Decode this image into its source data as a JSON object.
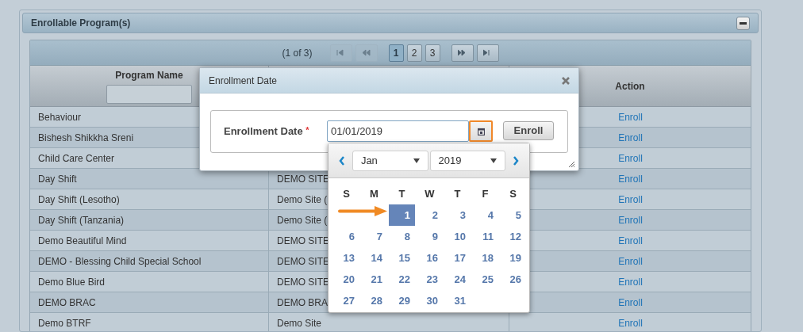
{
  "panel": {
    "title": "Enrollable Program(s)",
    "collapsed": false
  },
  "paginator": {
    "summary": "(1 of 3)",
    "nav": [
      {
        "kind": "first",
        "disabled": true
      },
      {
        "kind": "prev",
        "disabled": true
      },
      {
        "kind": "next",
        "disabled": false
      },
      {
        "kind": "last",
        "disabled": false
      }
    ],
    "pages": [
      {
        "label": "1",
        "selected": true
      },
      {
        "label": "2",
        "selected": false
      },
      {
        "label": "3",
        "selected": false
      }
    ]
  },
  "table": {
    "columns": [
      {
        "label": "Program Name",
        "filter": true
      },
      {
        "label": "Action",
        "filter": false
      }
    ],
    "rows": [
      {
        "name": "Behaviour",
        "action": "Enroll"
      },
      {
        "name": "Bishesh Shikkha Sreni",
        "action": "Enroll"
      },
      {
        "name": "Child Care Center",
        "action": "Enroll"
      },
      {
        "name": "Day Shift",
        "column_2": "DEMO SITE",
        "action": "Enroll"
      },
      {
        "name": "Day Shift (Lesotho)",
        "column_2": "Demo Site (",
        "action": "Enroll"
      },
      {
        "name": "Day Shift (Tanzania)",
        "column_2": "Demo Site (",
        "action": "Enroll"
      },
      {
        "name": "Demo Beautiful Mind",
        "column_2": "DEMO SITE",
        "action": "Enroll"
      },
      {
        "name": "DEMO - Blessing Child Special School",
        "column_2": "DEMO SITE",
        "action": "Enroll"
      },
      {
        "name": "Demo Blue Bird",
        "column_2": "DEMO SITE",
        "action": "Enroll"
      },
      {
        "name": "DEMO BRAC",
        "column_2": "DEMO BRA",
        "action": "Enroll"
      },
      {
        "name": "Demo BTRF",
        "column_2": "Demo Site",
        "action": "Enroll"
      }
    ]
  },
  "dialog": {
    "title": "Enrollment Date",
    "field_label": "Enrollment Date",
    "required_mark": "*",
    "value": "01/01/2019",
    "calendar_button_focused": true,
    "button": "Enroll"
  },
  "datepicker": {
    "month": "Jan",
    "year": "2019",
    "weekdays": [
      "S",
      "M",
      "T",
      "W",
      "T",
      "F",
      "S"
    ],
    "weeks": [
      [
        {
          "label": "1",
          "selected": true
        },
        {
          "label": "2",
          "selected": false
        },
        {
          "label": "3",
          "selected": false
        },
        {
          "label": "4",
          "selected": false
        },
        {
          "label": "5",
          "selected": false
        }
      ],
      [
        {
          "label": "6",
          "selected": false
        },
        {
          "label": "7",
          "selected": false
        },
        {
          "label": "8",
          "selected": false
        },
        {
          "label": "9",
          "selected": false
        },
        {
          "label": "10",
          "selected": false
        },
        {
          "label": "11",
          "selected": false
        },
        {
          "label": "12",
          "selected": false
        }
      ],
      [
        {
          "label": "13",
          "selected": false
        },
        {
          "label": "14",
          "selected": false
        },
        {
          "label": "15",
          "selected": false
        },
        {
          "label": "16",
          "selected": false
        },
        {
          "label": "17",
          "selected": false
        },
        {
          "label": "18",
          "selected": false
        },
        {
          "label": "19",
          "selected": false
        }
      ],
      [
        {
          "label": "20",
          "selected": false
        },
        {
          "label": "21",
          "selected": false
        },
        {
          "label": "22",
          "selected": false
        },
        {
          "label": "23",
          "selected": false
        },
        {
          "label": "24",
          "selected": false
        },
        {
          "label": "25",
          "selected": false
        },
        {
          "label": "26",
          "selected": false
        }
      ],
      [
        {
          "label": "27",
          "selected": false
        },
        {
          "label": "28",
          "selected": false
        },
        {
          "label": "29",
          "selected": false
        },
        {
          "label": "30",
          "selected": false
        },
        {
          "label": "31",
          "selected": false
        }
      ]
    ]
  }
}
